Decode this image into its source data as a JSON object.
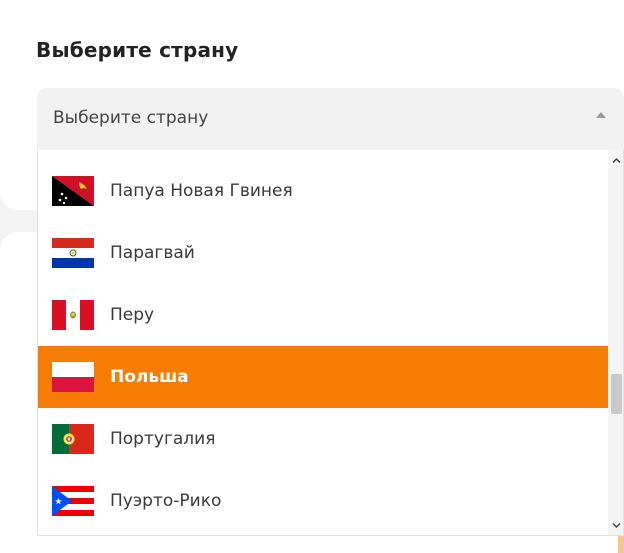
{
  "section": {
    "title": "Выберите страну"
  },
  "select": {
    "value": "Выберите страну"
  },
  "options": [
    {
      "label": "Папуа Новая Гвинея",
      "flag": "papua-new-guinea-flag-icon",
      "selected": false
    },
    {
      "label": "Парагвай",
      "flag": "paraguay-flag-icon",
      "selected": false
    },
    {
      "label": "Перу",
      "flag": "peru-flag-icon",
      "selected": false
    },
    {
      "label": "Польша",
      "flag": "poland-flag-icon",
      "selected": true
    },
    {
      "label": "Португалия",
      "flag": "portugal-flag-icon",
      "selected": false
    },
    {
      "label": "Пуэрто-Рико",
      "flag": "puerto-rico-flag-icon",
      "selected": false
    }
  ],
  "colors": {
    "accent": "#f67c05",
    "select_background": "#f2f2f2",
    "page_background": "#f3f3f3"
  },
  "scroll": {
    "position_fraction": 0.6
  }
}
